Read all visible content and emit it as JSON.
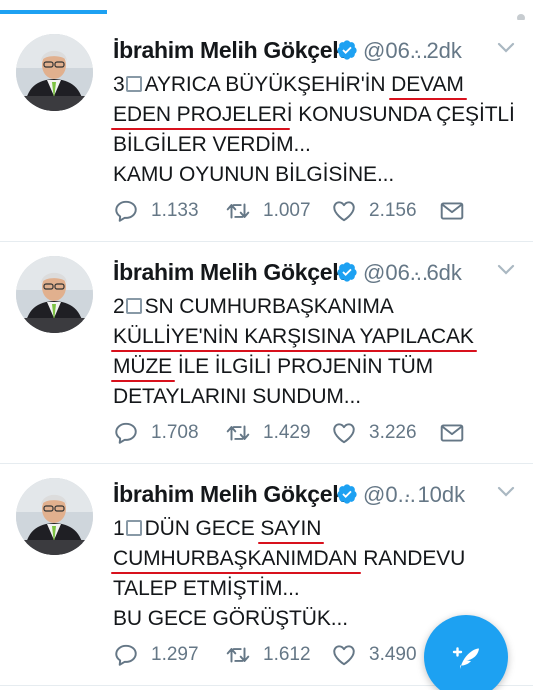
{
  "colors": {
    "accent": "#1da1f2",
    "underline": "#d8111d",
    "muted": "#657786"
  },
  "tweets": [
    {
      "name": "İbrahim Melih Gökçek",
      "handle": "@06...",
      "time": "· 2dk",
      "lines": [
        {
          "parts": [
            {
              "t": "3"
            },
            {
              "box": true
            },
            {
              "t": "AYRICA BÜYÜKŞEHİR'İN "
            },
            {
              "t": "DEVAM",
              "u": true
            }
          ]
        },
        {
          "parts": [
            {
              "t": "EDEN PROJELER",
              "u": true
            },
            {
              "t": "İ KONUSUNDA ÇEŞİTLİ"
            }
          ]
        },
        {
          "parts": [
            {
              "t": "BİLGİLER VERDİM..."
            }
          ]
        },
        {
          "parts": [
            {
              "t": "KAMU OYUNUN BİLGİSİNE..."
            }
          ]
        }
      ],
      "replies": "1.133",
      "retweets": "1.007",
      "likes": "2.156"
    },
    {
      "name": "İbrahim Melih Gökçek",
      "handle": "@06...",
      "time": "· 6dk",
      "lines": [
        {
          "parts": [
            {
              "t": "2"
            },
            {
              "box": true
            },
            {
              "t": "SN CUMHURBAŞKANIMA"
            }
          ]
        },
        {
          "parts": [
            {
              "t": "KÜLLİYE'NİN KARŞISINA YAPILACAK",
              "u": true
            }
          ]
        },
        {
          "parts": [
            {
              "t": "MÜZE",
              "u": true
            },
            {
              "t": " İLE İLGİLİ PROJENİN TÜM"
            }
          ]
        },
        {
          "parts": [
            {
              "t": "DETAYLARINI SUNDUM..."
            }
          ]
        }
      ],
      "replies": "1.708",
      "retweets": "1.429",
      "likes": "3.226"
    },
    {
      "name": "İbrahim Melih Gökçek",
      "handle": "@0...",
      "time": "· 10dk",
      "lines": [
        {
          "parts": [
            {
              "t": "1"
            },
            {
              "box": true
            },
            {
              "t": "DÜN GECE "
            },
            {
              "t": "SAYIN",
              "u": true
            }
          ]
        },
        {
          "parts": [
            {
              "t": "CUMHURBAŞKANIMDAN",
              "u": true
            },
            {
              "t": " RANDEVU"
            }
          ]
        },
        {
          "parts": [
            {
              "t": "TALEP ETMİŞTİM..."
            }
          ]
        },
        {
          "parts": [
            {
              "t": "BU GECE GÖRÜŞTÜK..."
            }
          ]
        }
      ],
      "replies": "1.297",
      "retweets": "1.612",
      "likes": "3.490"
    }
  ],
  "icons": {
    "reply": "reply-icon",
    "retweet": "retweet-icon",
    "like": "heart-icon",
    "message": "envelope-icon",
    "compose": "compose-tweet-icon"
  }
}
